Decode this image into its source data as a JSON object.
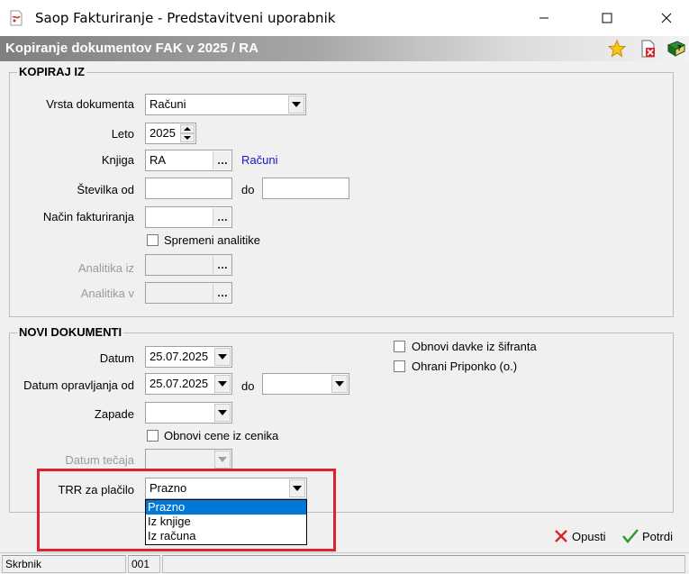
{
  "window": {
    "title": "Saop Fakturiranje - Predstavitveni uporabnik"
  },
  "header": {
    "title": "Kopiranje dokumentov FAK v 2025 / RA"
  },
  "kopiraj_iz": {
    "legend": "KOPIRAJ IZ",
    "vrsta_label": "Vrsta dokumenta",
    "vrsta_value": "Računi",
    "leto_label": "Leto",
    "leto_value": "2025",
    "knjiga_label": "Knjiga",
    "knjiga_value": "RA",
    "knjiga_name": "Računi",
    "stevilka_label": "Številka od",
    "stevilka_od": "",
    "do_label": "do",
    "stevilka_do": "",
    "nacin_label": "Način fakturiranja",
    "nacin_value": "",
    "spremeni_label": "Spremeni analitike",
    "analitika_iz_label": "Analitika iz",
    "analitika_v_label": "Analitika v"
  },
  "novi_dokumenti": {
    "legend": "NOVI DOKUMENTI",
    "datum_label": "Datum",
    "datum_value": "25.07.2025",
    "datum_opr_label": "Datum opravljanja od",
    "datum_opr_value": "25.07.2025",
    "do_label": "do",
    "datum_opr_do": "",
    "zapade_label": "Zapade",
    "zapade_value": "",
    "obnovi_cene_label": "Obnovi cene iz cenika",
    "datum_tecaja_label": "Datum tečaja",
    "trr_label": "TRR za plačilo",
    "trr_value": "Prazno",
    "trr_options": [
      "Prazno",
      "Iz knjige",
      "Iz računa"
    ],
    "obnovi_davke_label": "Obnovi davke iz šifranta",
    "ohrani_priponko_label": "Ohrani Priponko (o.)"
  },
  "buttons": {
    "opusti": "Opusti",
    "potrdi": "Potrdi"
  },
  "status": {
    "user": "Skrbnik",
    "code": "001"
  },
  "colors": {
    "highlight": "#e0202a",
    "link": "#1515c8",
    "selection": "#0078d7"
  }
}
